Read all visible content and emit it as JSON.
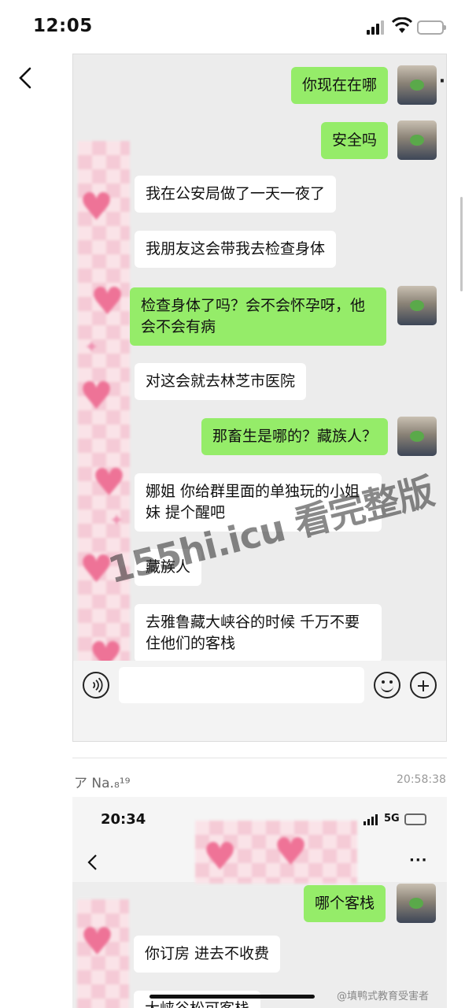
{
  "status_bar": {
    "time": "12:05"
  },
  "screenshot1": {
    "more": "···",
    "messages": [
      {
        "side": "me",
        "text": "你现在在哪"
      },
      {
        "side": "me",
        "text": "安全吗"
      },
      {
        "side": "other",
        "text": "我在公安局做了一天一夜了"
      },
      {
        "side": "other",
        "text": "我朋友这会带我去检查身体"
      },
      {
        "side": "me",
        "text": "检查身体了吗？会不会怀孕呀，他会不会有病"
      },
      {
        "side": "other",
        "text": "对这会就去林芝市医院"
      },
      {
        "side": "me",
        "text": "那畜生是哪的？藏族人？"
      },
      {
        "side": "other",
        "text": "娜姐 你给群里面的单独玩的小姐妹 提个醒吧"
      },
      {
        "side": "other",
        "text": "藏族人"
      },
      {
        "side": "other",
        "text": "去雅鲁藏大峡谷的时候 千万不要住他们的客栈"
      }
    ],
    "input_placeholder": ""
  },
  "watermark": "155hi.icu 看完整版",
  "post": {
    "poster": "ア Na.₈¹⁹",
    "time": "20:58:38"
  },
  "screenshot2": {
    "time": "20:34",
    "network": "5G",
    "more": "···",
    "messages": [
      {
        "side": "me",
        "text": "哪个客栈"
      },
      {
        "side": "other",
        "text": "你订房 进去不收费"
      },
      {
        "side": "other",
        "text": "大峡谷松可客栈"
      }
    ]
  },
  "source_watermark": "@填鸭式教育受害者",
  "colors": {
    "me_bubble": "#95ec69",
    "other_bubble": "#ffffff",
    "chat_bg": "#ececec"
  }
}
